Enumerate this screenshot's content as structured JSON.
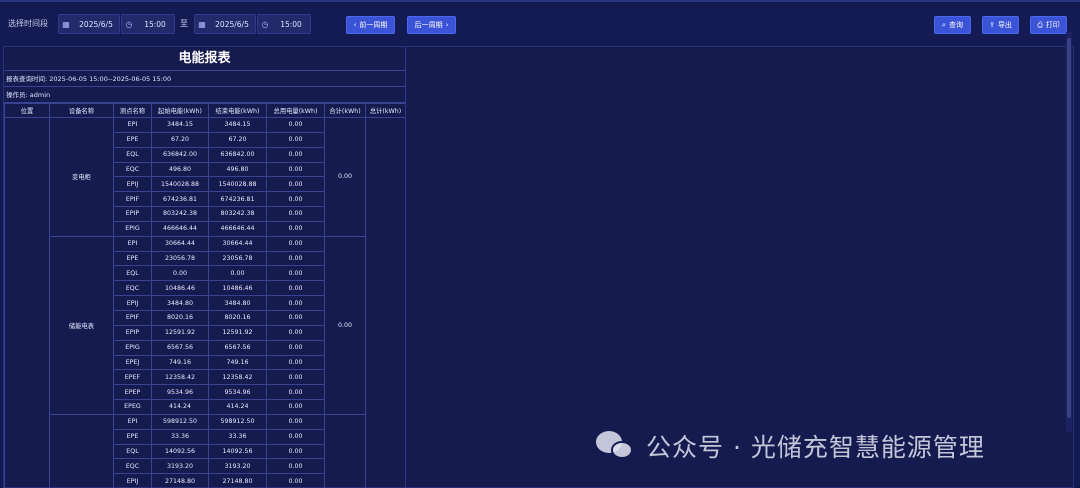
{
  "toolbar": {
    "range_label": "选择时间段",
    "start_date": "2025/6/5",
    "start_time": "15:00",
    "to_label": "至",
    "end_date": "2025/6/5",
    "end_time": "15:00",
    "prev_week": "前一周期",
    "next_week": "后一周期",
    "query": "查询",
    "export": "导出",
    "print": "打印"
  },
  "report": {
    "title": "电能报表",
    "query_time": "报表查询时间: 2025-06-05 15:00--2025-06-05 15:00",
    "operator": "操作员: admin",
    "columns": [
      "位置",
      "设备名称",
      "测点名称",
      "起始电能(kWh)",
      "结束电能(kWh)",
      "总用电量(kWh)",
      "合计(kWh)",
      "总计(kWh)"
    ],
    "groups": [
      {
        "device": "变电柜",
        "subtotal": "0.00",
        "rows": [
          [
            "EPI",
            "3484.15",
            "3484.15",
            "0.00"
          ],
          [
            "EPE",
            "67.20",
            "67.20",
            "0.00"
          ],
          [
            "EQL",
            "636842.00",
            "636842.00",
            "0.00"
          ],
          [
            "EQC",
            "496.80",
            "496.80",
            "0.00"
          ],
          [
            "EPIJ",
            "1540028.88",
            "1540028.88",
            "0.00"
          ],
          [
            "EPIF",
            "674236.81",
            "674236.81",
            "0.00"
          ],
          [
            "EPIP",
            "803242.38",
            "803242.38",
            "0.00"
          ],
          [
            "EPIG",
            "466646.44",
            "466646.44",
            "0.00"
          ]
        ]
      },
      {
        "device": "储能电表",
        "subtotal": "0.00",
        "rows": [
          [
            "EPI",
            "30664.44",
            "30664.44",
            "0.00"
          ],
          [
            "EPE",
            "23056.78",
            "23056.78",
            "0.00"
          ],
          [
            "EQL",
            "0.00",
            "0.00",
            "0.00"
          ],
          [
            "EQC",
            "10486.46",
            "10486.46",
            "0.00"
          ],
          [
            "EPIJ",
            "3484.80",
            "3484.80",
            "0.00"
          ],
          [
            "EPIF",
            "8020.16",
            "8020.16",
            "0.00"
          ],
          [
            "EPIP",
            "12591.92",
            "12591.92",
            "0.00"
          ],
          [
            "EPIG",
            "6567.56",
            "6567.56",
            "0.00"
          ],
          [
            "EPEJ",
            "749.16",
            "749.16",
            "0.00"
          ],
          [
            "EPEF",
            "12358.42",
            "12358.42",
            "0.00"
          ],
          [
            "EPEP",
            "9534.96",
            "9534.96",
            "0.00"
          ],
          [
            "EPEG",
            "414.24",
            "414.24",
            "0.00"
          ]
        ]
      },
      {
        "device": "",
        "subtotal": "",
        "rows": [
          [
            "EPI",
            "598912.50",
            "598912.50",
            "0.00"
          ],
          [
            "EPE",
            "33.36",
            "33.36",
            "0.00"
          ],
          [
            "EQL",
            "14092.56",
            "14092.56",
            "0.00"
          ],
          [
            "EQC",
            "3193.20",
            "3193.20",
            "0.00"
          ],
          [
            "EPIJ",
            "27148.80",
            "27148.80",
            "0.00"
          ]
        ]
      }
    ]
  },
  "watermark": "公众号 · 光储充智慧能源管理"
}
